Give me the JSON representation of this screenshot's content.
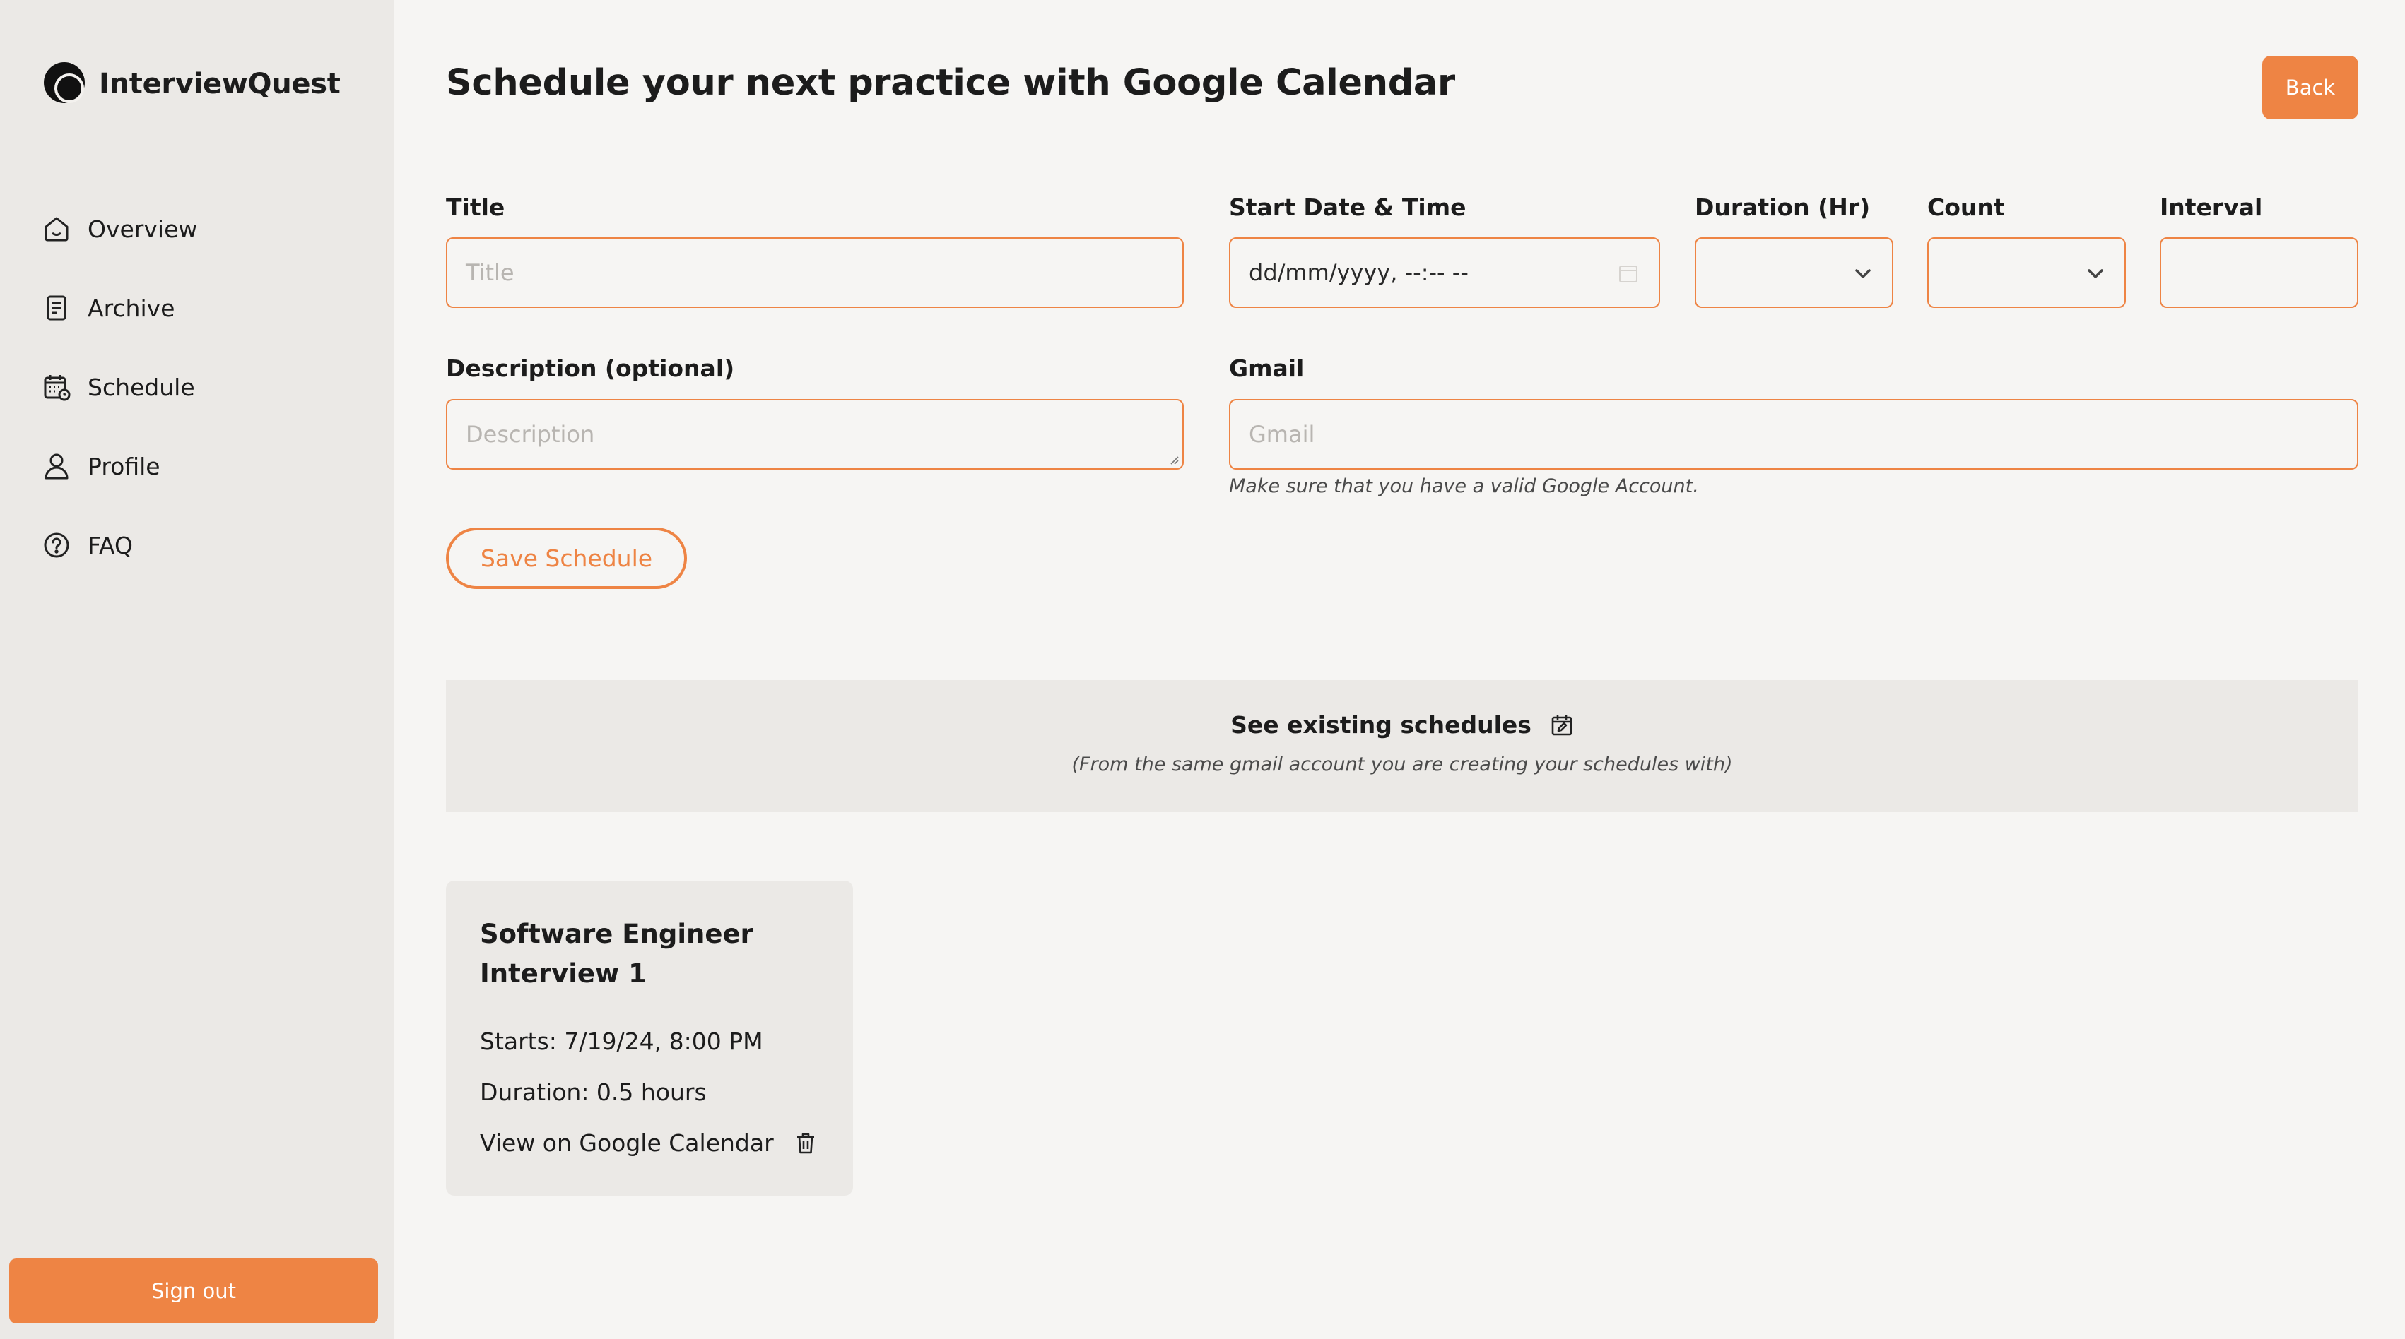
{
  "sidebar": {
    "brand": "InterviewQuest",
    "items": [
      {
        "label": "Overview",
        "icon": "home-icon"
      },
      {
        "label": "Archive",
        "icon": "document-icon"
      },
      {
        "label": "Schedule",
        "icon": "calendar-clock-icon"
      },
      {
        "label": "Profile",
        "icon": "user-icon"
      },
      {
        "label": "FAQ",
        "icon": "help-circle-icon"
      }
    ],
    "signout_label": "Sign out"
  },
  "header": {
    "title": "Schedule your next practice with Google Calendar",
    "back_label": "Back"
  },
  "form": {
    "title_label": "Title",
    "title_placeholder": "Title",
    "start_label": "Start Date & Time",
    "start_value": "dd/mm/yyyy, --:-- --",
    "duration_label": "Duration (Hr)",
    "count_label": "Count",
    "interval_label": "Interval",
    "description_label": "Description (optional)",
    "description_placeholder": "Description",
    "gmail_label": "Gmail",
    "gmail_placeholder": "Gmail",
    "gmail_hint": "Make sure that you have a valid Google Account.",
    "save_label": "Save Schedule"
  },
  "existing": {
    "title": "See existing schedules",
    "subtitle": "(From the same gmail account you are creating your schedules with)"
  },
  "schedules": [
    {
      "title": "Software Engineer Interview 1",
      "starts": "Starts: 7/19/24, 8:00 PM",
      "duration": "Duration: 0.5 hours",
      "link": "View on Google Calendar"
    }
  ],
  "colors": {
    "accent": "#ee8444",
    "sidebar_bg": "#ebe9e6",
    "page_bg": "#f6f5f3"
  }
}
